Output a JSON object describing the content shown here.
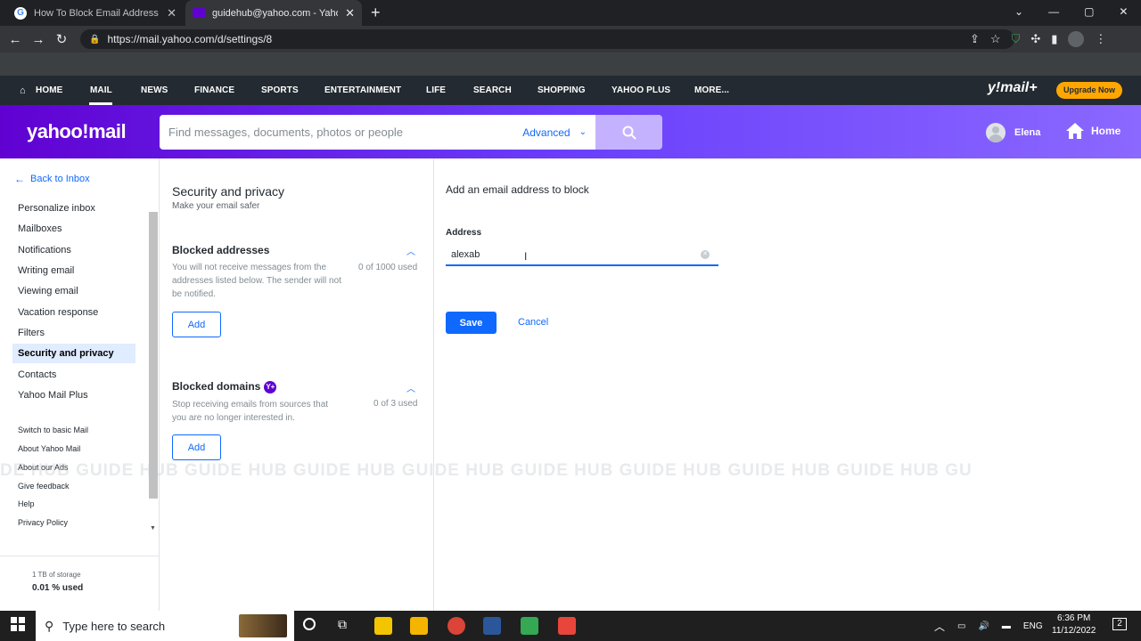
{
  "browser": {
    "tabs": [
      {
        "title": "How To Block Email Address On",
        "icon": "google-g-icon"
      },
      {
        "title": "guidehub@yahoo.com - Yahoo Mail",
        "icon": "yahoo-mail-icon"
      }
    ],
    "url": "https://mail.yahoo.com/d/settings/8"
  },
  "ynav": {
    "items": [
      "HOME",
      "MAIL",
      "NEWS",
      "FINANCE",
      "SPORTS",
      "ENTERTAINMENT",
      "LIFE",
      "SEARCH",
      "SHOPPING",
      "YAHOO PLUS",
      "MORE..."
    ],
    "brand": "y!mail+",
    "upgrade": "Upgrade Now"
  },
  "header": {
    "logo": "yahoo!mail",
    "search_placeholder": "Find messages, documents, photos or people",
    "advanced": "Advanced",
    "user": "Elena",
    "home": "Home"
  },
  "leftnav": {
    "back": "Back to Inbox",
    "items": [
      "Personalize inbox",
      "Mailboxes",
      "Notifications",
      "Writing email",
      "Viewing email",
      "Vacation response",
      "Filters",
      "Security and privacy",
      "Contacts",
      "Yahoo Mail Plus"
    ],
    "small": [
      "Switch to basic Mail",
      "About Yahoo Mail",
      "About our Ads",
      "Give feedback",
      "Help",
      "Privacy Policy"
    ],
    "storage": "1 TB of storage",
    "storage_used": "0.01 % used"
  },
  "middle": {
    "title": "Security and privacy",
    "subtitle": "Make your email safer",
    "blocked_addresses": {
      "title": "Blocked addresses",
      "desc": "You will not receive messages from the addresses listed below. The sender will not be notified.",
      "count": "0 of 1000 used",
      "add": "Add"
    },
    "blocked_domains": {
      "title": "Blocked domains",
      "badge": "Y+",
      "desc": "Stop receiving emails from sources that you are no longer interested in.",
      "count": "0 of 3 used",
      "add": "Add"
    }
  },
  "right": {
    "title": "Add an email address to block",
    "address_label": "Address",
    "address_value": "alexab",
    "save": "Save",
    "cancel": "Cancel"
  },
  "watermark": "DE HUB   GUIDE HUB   GUIDE HUB   GUIDE HUB   GUIDE HUB   GUIDE HUB   GUIDE HUB   GUIDE HUB   GUIDE HUB   GU",
  "taskbar": {
    "search_placeholder": "Type here to search",
    "lang": "ENG",
    "time": "6:36 PM",
    "date": "11/12/2022",
    "notification_count": "2"
  },
  "colors": {
    "accent": "#0f69ff",
    "purple": "#6001d2",
    "upgrade": "#ffa700"
  }
}
